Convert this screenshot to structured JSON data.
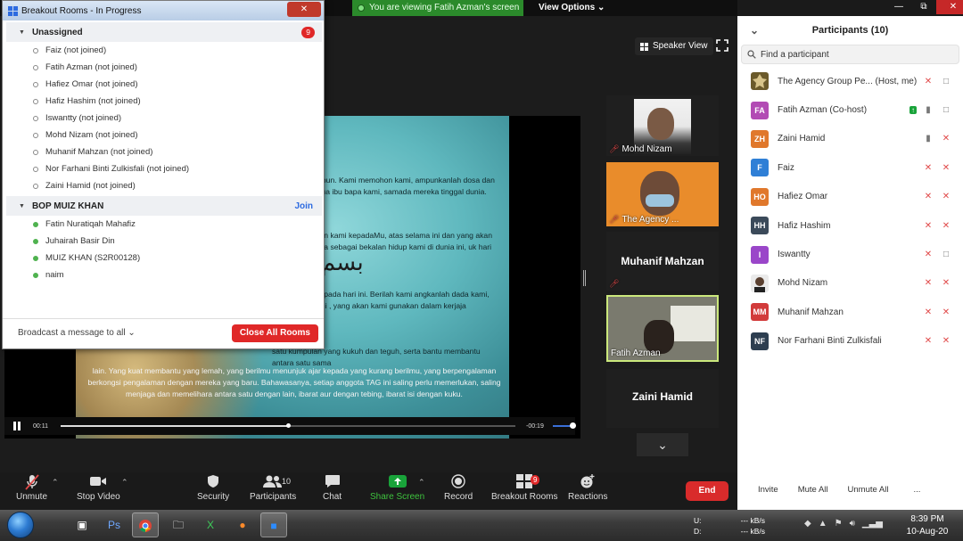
{
  "topbar": {
    "viewing_text": "You are viewing Fatih Azman's screen",
    "view_options": "View Options ⌄",
    "win_min": "—",
    "win_max": "⧉",
    "win_close": "✕"
  },
  "main": {
    "speaker_view": "Speaker View",
    "shared_slide": {
      "title": "بسم",
      "para1": "Maha Pengampun. Kami memohon kami, ampunkanlah dosa dan kesalahan kedua ibu bapa kami, samada mereka tinggal dunia.",
      "para2": "rasa kesyukuran kami kepadaMu, atas selama ini dan yang akan datang. Semoga sebagai bekalan hidup kami di dunia ini, uk hari akhirat kelak.",
      "para3": "g kami adakan pada hari ini. Berilah kami angkanlah dada kami, agar dapat kami , yang akan kami gunakan dalam kerjaja",
      "para4": "satu kumpulan yang kukuh dan teguh, serta bantu membantu antara satu sama",
      "bottom": "lain. Yang kuat membantu yang lemah, yang berilmu menunjuk ajar kepada yang kurang berilmu, yang berpengalaman berkongsi pengalaman dengan mereka yang baru. Bahawasanya, setiap anggota TAG ini saling perlu memerlukan, saling menjaga dan memelihara antara satu dengan lain, ibarat aur dengan tebing, ibarat isi dengan kuku."
    },
    "player": {
      "time_start": "00:11",
      "time_end": "-00:19",
      "progress": 0.5
    },
    "tiles": {
      "t1_name": "Mohd Nizam",
      "t2_name": "The Agency ...",
      "t3_name": "Muhanif Mahzan",
      "t4_name": "Fatih Azman",
      "t5_name": "Zaini Hamid"
    }
  },
  "toolbar": {
    "unmute": "Unmute",
    "stop_video": "Stop Video",
    "security": "Security",
    "participants": "Participants",
    "participants_count": "10",
    "chat": "Chat",
    "share_screen": "Share Screen",
    "record": "Record",
    "breakout_rooms": "Breakout Rooms",
    "breakout_badge": "9",
    "reactions": "Reactions",
    "end": "End"
  },
  "participants_panel": {
    "title": "Participants (10)",
    "search_placeholder": "Find a participant",
    "rows": [
      {
        "initials": "",
        "name": "The Agency Group Pe...",
        "meta": "(Host, me)",
        "color": "#6b5a2a"
      },
      {
        "initials": "FA",
        "name": "Fatih Azman (Co-host)",
        "meta": "",
        "color": "#b24bb4"
      },
      {
        "initials": "ZH",
        "name": "Zaini Hamid",
        "meta": "",
        "color": "#e0782c"
      },
      {
        "initials": "F",
        "name": "Faiz",
        "meta": "",
        "color": "#2f7fd6"
      },
      {
        "initials": "HO",
        "name": "Hafiez Omar",
        "meta": "",
        "color": "#e0782c"
      },
      {
        "initials": "HH",
        "name": "Hafiz Hashim",
        "meta": "",
        "color": "#3b4a5a"
      },
      {
        "initials": "I",
        "name": "Iswantty",
        "meta": "",
        "color": "#9a46c9"
      },
      {
        "initials": "",
        "name": "Mohd Nizam",
        "meta": "",
        "color": "#777777"
      },
      {
        "initials": "MM",
        "name": "Muhanif Mahzan",
        "meta": "",
        "color": "#d23b3b"
      },
      {
        "initials": "NF",
        "name": "Nor Farhani Binti Zulkisfali",
        "meta": "",
        "color": "#2d3e50"
      }
    ],
    "invite": "Invite",
    "mute_all": "Mute All",
    "unmute_all": "Unmute All",
    "more": "..."
  },
  "breakout": {
    "title": "Breakout Rooms - In Progress",
    "unassigned_label": "Unassigned",
    "unassigned_count": "9",
    "unassigned": [
      "Faiz (not joined)",
      "Fatih Azman (not joined)",
      "Hafiez Omar (not joined)",
      "Hafiz Hashim (not joined)",
      "Iswantty (not joined)",
      "Mohd Nizam (not joined)",
      "Muhanif Mahzan (not joined)",
      "Nor Farhani Binti Zulkisfali (not joined)",
      "Zaini Hamid (not joined)"
    ],
    "room_label": "BOP MUIZ KHAN",
    "join_label": "Join",
    "room_members": [
      "Fatin Nuratiqah Mahafiz",
      "Juhairah Basir Din",
      "MUIZ KHAN (S2R00128)",
      "naim"
    ],
    "broadcast": "Broadcast a message to all ⌄",
    "close_all": "Close All Rooms"
  },
  "taskbar": {
    "net_up_label": "U:",
    "net_up_value": "--- kB/s",
    "net_down_label": "D:",
    "net_down_value": "--- kB/s",
    "time": "8:39 PM",
    "date": "10-Aug-20"
  }
}
